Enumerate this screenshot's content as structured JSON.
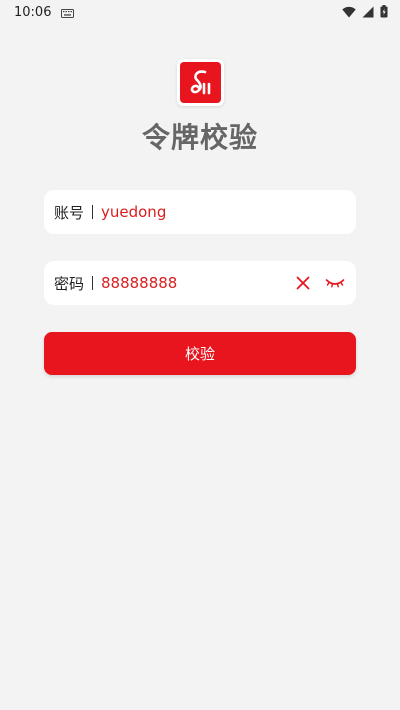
{
  "status_bar": {
    "time": "10:06",
    "icons": [
      "keyboard-icon",
      "wifi-icon",
      "signal-icon",
      "battery-icon"
    ]
  },
  "header": {
    "logo_icon": "app-logo-icon",
    "title": "令牌校验"
  },
  "form": {
    "account": {
      "label": "账号",
      "value": "yuedong"
    },
    "password": {
      "label": "密码",
      "value": "88888888",
      "actions": [
        "clear-icon",
        "eye-closed-icon"
      ]
    },
    "submit_label": "校验"
  },
  "colors": {
    "accent": "#e8141e",
    "input_text": "#d81e1e",
    "title": "#666666",
    "background": "#f3f3f3"
  }
}
